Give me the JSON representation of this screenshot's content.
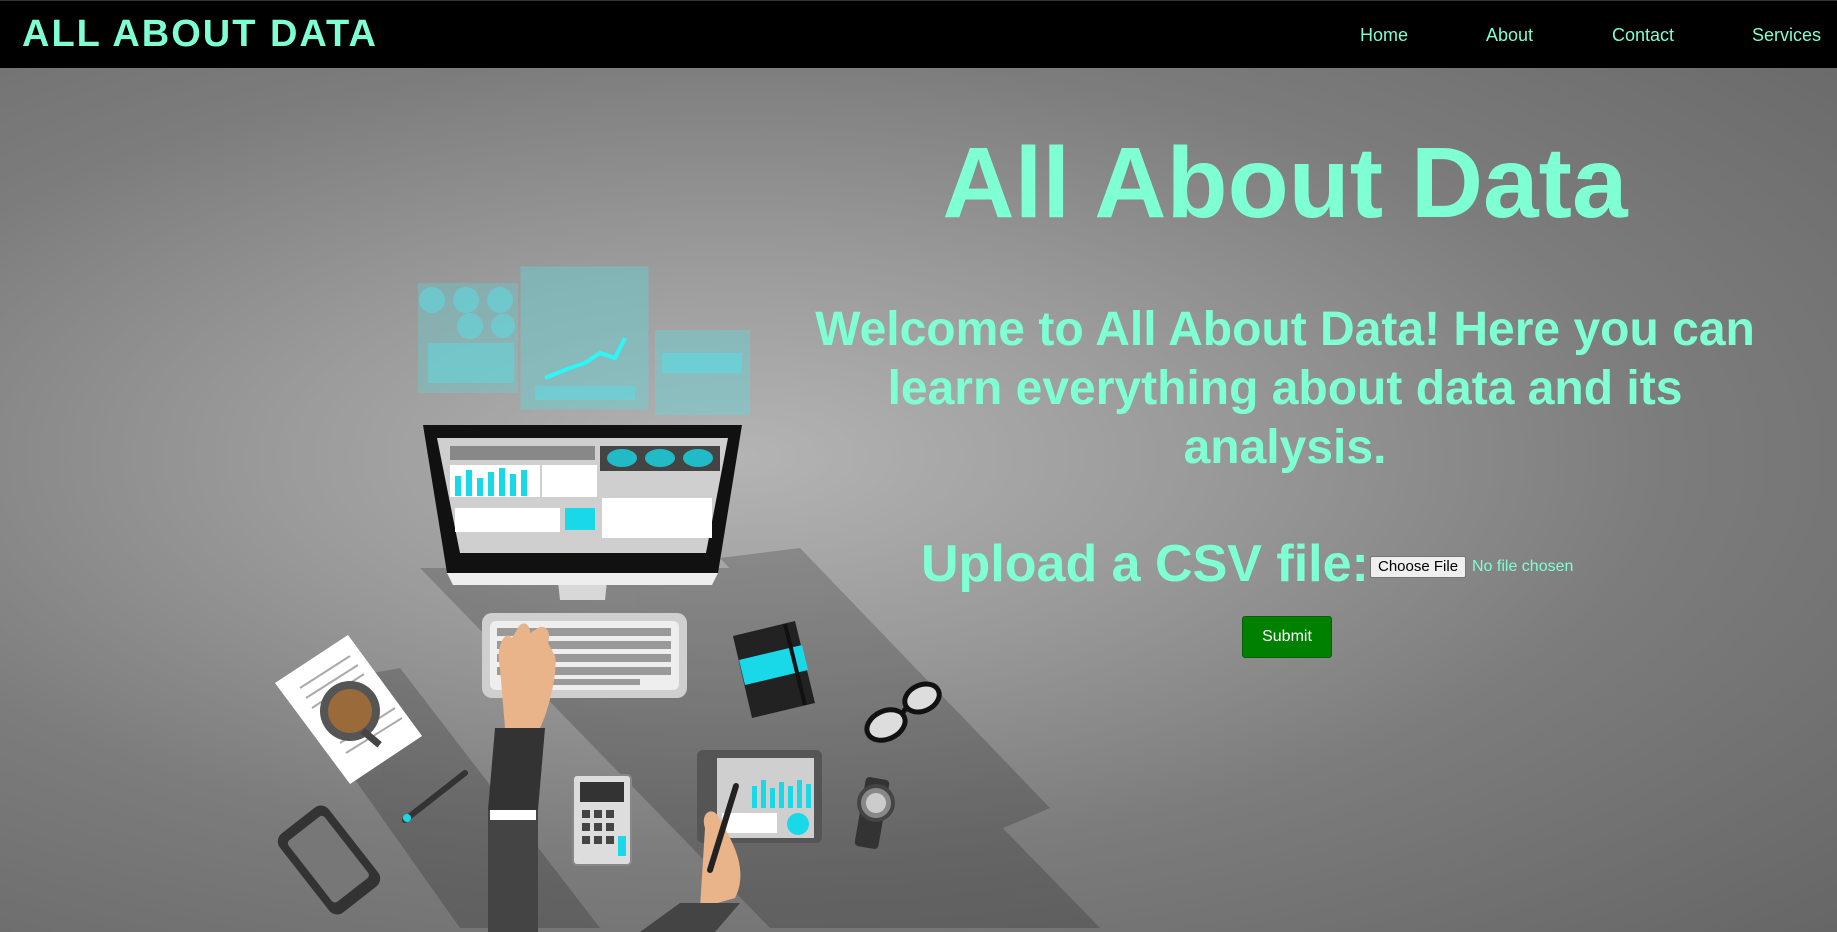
{
  "navbar": {
    "brand": "ALL ABOUT DATA",
    "links": [
      {
        "label": "Home"
      },
      {
        "label": "About"
      },
      {
        "label": "Contact"
      },
      {
        "label": "Services"
      }
    ]
  },
  "hero": {
    "title": "All About Data",
    "welcome": "Welcome to All About Data! Here you can learn everything about data and its analysis.",
    "upload_label": "Upload a CSV file:",
    "file_button_label": "Choose File",
    "file_status": "No file chosen",
    "submit_label": "Submit"
  },
  "colors": {
    "accent": "#7fffd4",
    "navbar_bg": "#000000",
    "submit_bg": "#008000",
    "cyan": "#19d9e8"
  },
  "icons": [
    "monitor-icon",
    "keyboard-icon",
    "coffee-cup-icon",
    "phone-icon",
    "pen-icon",
    "notebook-icon",
    "tablet-icon",
    "calculator-icon",
    "glasses-icon",
    "watch-icon",
    "hologram-screens-icon",
    "hand-icon"
  ]
}
